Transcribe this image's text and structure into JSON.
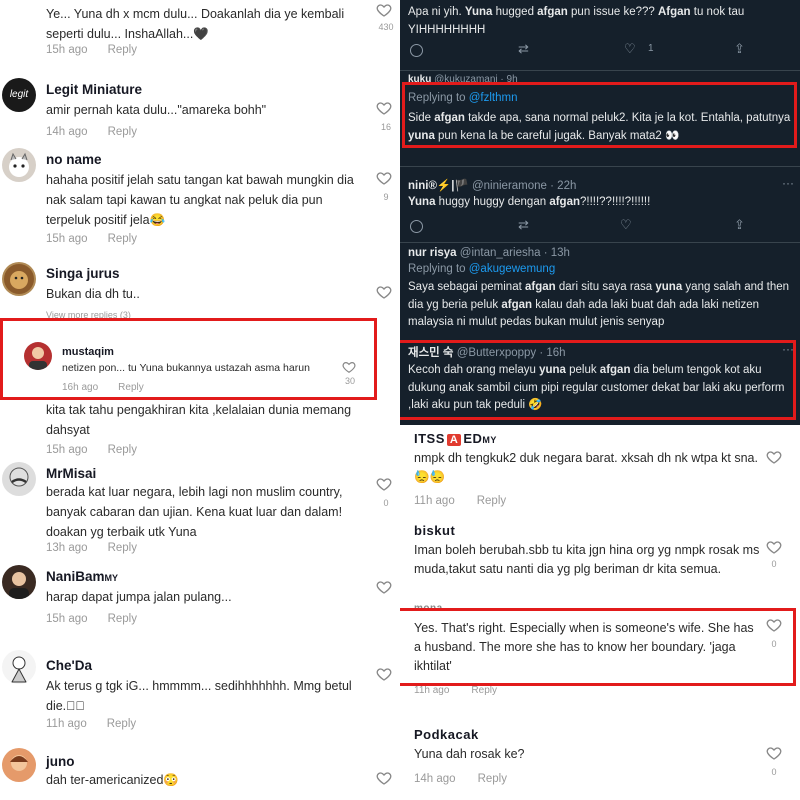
{
  "left": {
    "comments": [
      {
        "name": "",
        "text": "Ye... Yuna dh x mcm dulu... Doakanlah dia ye kembali seperti dulu... InshaAllah...🖤",
        "time": "15h ago",
        "reply": "Reply",
        "likes": "430"
      },
      {
        "name": "Legit Miniature",
        "avatar_text": "legit",
        "text": "amir pernah kata dulu...\"amareka bohh\"",
        "time": "14h ago",
        "reply": "Reply",
        "likes": "16"
      },
      {
        "name": "no name",
        "text": "hahaha positif jelah satu tangan kat bawah mungkin dia nak salam tapi kawan tu angkat nak peluk dia pun terpeluk positif jela😂",
        "time": "15h ago",
        "reply": "Reply",
        "likes": "9"
      },
      {
        "name": "Singa jurus",
        "text": "Bukan dia dh tu..",
        "time": "",
        "reply": "",
        "likes": "",
        "sub": "View more replies (3)"
      },
      {
        "name": "mustaqim",
        "text": "netizen pon... tu Yuna bukannya ustazah asma harun",
        "time": "16h ago",
        "reply": "Reply",
        "likes": "30"
      },
      {
        "name": "",
        "text": "kita tak tahu pengakhiran kita ,kelalaian dunia memang dahsyat",
        "time": "15h ago",
        "reply": "Reply",
        "likes": ""
      },
      {
        "name": "MrMisai",
        "text": "berada kat luar negara, lebih lagi non muslim country, banyak cabaran dan ujian. Kena kuat luar dan dalam! doakan yg terbaik utk Yuna",
        "time": "13h ago",
        "reply": "Reply",
        "likes": "0"
      },
      {
        "name": "NaniBam",
        "name_suffix": "MY",
        "text": "harap dapat jumpa jalan pulang...",
        "time": "15h ago",
        "reply": "Reply",
        "likes": ""
      },
      {
        "name": "Che'Da",
        "text": "Ak terus g tgk iG... hmmmm... sedihhhhhhh. Mmg betul die.⃞⃞",
        "time": "11h ago",
        "reply": "Reply",
        "likes": ""
      },
      {
        "name": "juno",
        "text": "dah ter-americanized😳",
        "time": "",
        "reply": "",
        "likes": ""
      }
    ]
  },
  "tweets": [
    {
      "name": "",
      "handle": "",
      "text_parts": [
        "Apa ni yih. ",
        "Yuna",
        " hugged ",
        "afgan",
        " pun issue ke??? ",
        "Afgan",
        " tu nok tau YIHHHHHHHH"
      ],
      "likes": "1"
    },
    {
      "name": "kuku",
      "handle": "@kukuzamani · 9h",
      "replying": "Replying to",
      "replying_to": "@fzlthmn",
      "text_parts": [
        "Side ",
        "afgan",
        " takde apa, sana normal peluk2. Kita je la kot. Entahla, patutnya ",
        "yuna",
        " pun kena la be careful jugak. Banyak mata2 👀"
      ]
    },
    {
      "name": "nini®⚡|🏴",
      "handle": "@ninieramone · 22h",
      "text_parts": [
        "Yuna",
        " huggy huggy dengan ",
        "afgan",
        "?!!!!??!!!!?!!!!!!"
      ]
    },
    {
      "name": "nur risya",
      "handle": "@intan_ariesha · 13h",
      "replying": "Replying to",
      "replying_to": "@akugewemung",
      "text_parts": [
        "Saya sebagai peminat ",
        "afgan",
        " dari situ saya rasa ",
        "yuna",
        " yang salah and then dia yg beria peluk ",
        "afgan",
        " kalau dah ada laki buat dah ada laki netizen malaysia ni mulut pedas bukan mulut jenis senyap"
      ]
    },
    {
      "name": "재스민 숙",
      "handle": "@Butterxpoppy · 16h",
      "text_parts": [
        "Kecoh dah orang melayu  ",
        "yuna",
        " peluk ",
        "afgan",
        " dia belum tengok kot aku dukung anak sambil cium pipi regular customer dekat bar laki aku perform ,laki aku pun tak peduli 🤣"
      ]
    }
  ],
  "right": {
    "comments": [
      {
        "name_pre": "ITSS",
        "badge": "A",
        "name_post": "ED",
        "name_suffix": "MY",
        "text": "nmpk dh tengkuk2 duk negara barat. xksah dh nk wtpa kt sna. 😓😓",
        "time": "11h ago",
        "reply": "Reply",
        "likes": ""
      },
      {
        "name": "biskut",
        "text": "Iman boleh berubah.sbb tu kita jgn hina org yg nmpk rosak ms muda,takut satu nanti dia yg plg beriman dr kita semua.",
        "time": "",
        "reply": "",
        "likes": "0"
      },
      {
        "name": "mona",
        "text": "Yes. That's right. Especially when is someone's wife. She has a husband. The more she has to know her boundary. 'jaga ikhtilat'",
        "time": "11h ago",
        "reply": "Reply",
        "likes": "0"
      },
      {
        "name": "Podkacak",
        "text": "Yuna dah rosak ke?",
        "time": "14h ago",
        "reply": "Reply",
        "likes": "0"
      }
    ]
  },
  "colors": {
    "highlight": "#e21b1b",
    "twitter_bg": "#15202b",
    "twitter_link": "#1d9bf0"
  }
}
